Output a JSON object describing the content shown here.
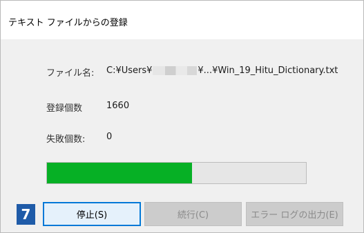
{
  "window": {
    "title": "テキスト ファイルからの登録"
  },
  "fields": [
    {
      "label": "ファイル名:",
      "value_prefix": "C:¥Users¥",
      "value_suffix": "¥...¥Win_19_Hitu_Dictionary.txt"
    },
    {
      "label": "登録個数",
      "value": "1660"
    },
    {
      "label": "失敗個数:",
      "value": "0"
    }
  ],
  "progress": {
    "fraction": 0.56,
    "color": "#06b025"
  },
  "buttons": {
    "stop": "停止(S)",
    "continue": "続行(C)",
    "export_errors": "エラー ログの出力(E)"
  },
  "step_badge": "7"
}
